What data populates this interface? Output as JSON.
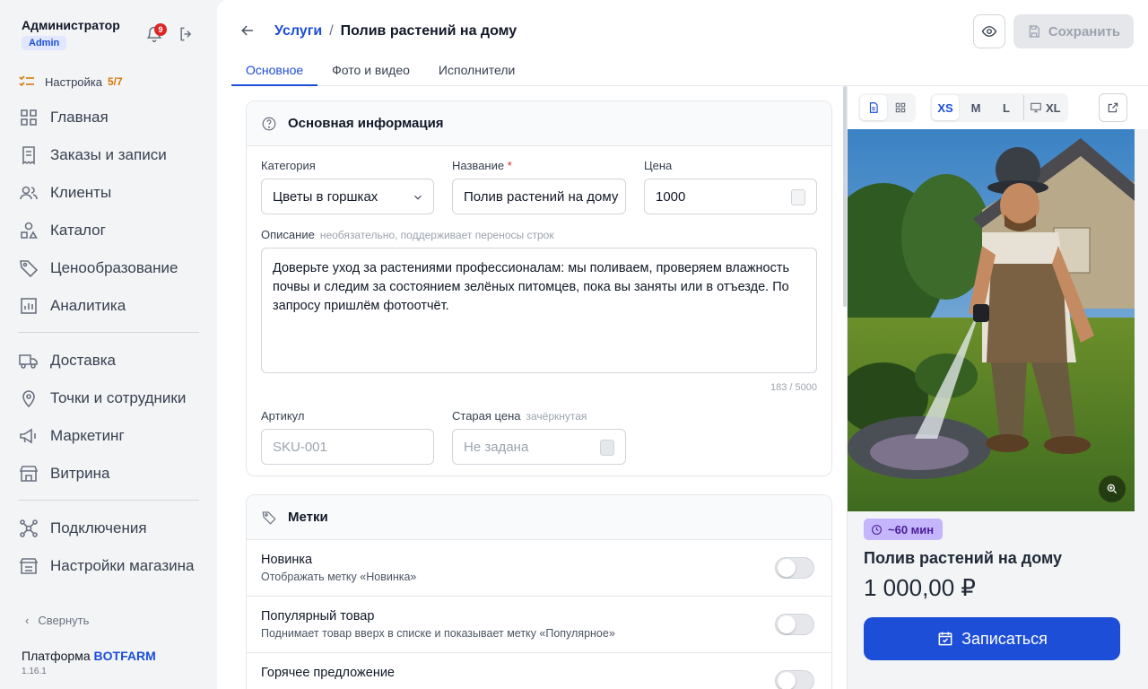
{
  "user": {
    "name": "Администратор",
    "role": "Admin",
    "notifications": "9"
  },
  "sidebar": {
    "setup": {
      "label": "Настройка",
      "progress": "5/7"
    },
    "groups": [
      [
        {
          "label": "Главная",
          "icon": "grid-icon"
        },
        {
          "label": "Заказы и записи",
          "icon": "receipt-icon"
        },
        {
          "label": "Клиенты",
          "icon": "users-icon"
        },
        {
          "label": "Каталог",
          "icon": "shapes-icon"
        },
        {
          "label": "Ценообразование",
          "icon": "tag-icon"
        },
        {
          "label": "Аналитика",
          "icon": "chart-icon"
        }
      ],
      [
        {
          "label": "Доставка",
          "icon": "truck-icon"
        },
        {
          "label": "Точки и сотрудники",
          "icon": "map-pin-icon"
        },
        {
          "label": "Маркетинг",
          "icon": "megaphone-icon"
        },
        {
          "label": "Витрина",
          "icon": "store-icon"
        }
      ],
      [
        {
          "label": "Подключения",
          "icon": "network-icon"
        },
        {
          "label": "Настройки магазина",
          "icon": "store-settings-icon"
        }
      ]
    ],
    "collapse": "Свернуть",
    "platform_prefix": "Платформа",
    "platform_brand": "BOTFARM",
    "version": "1.16.1"
  },
  "header": {
    "breadcrumb_link": "Услуги",
    "separator": "/",
    "breadcrumb_current": "Полив растений на дому",
    "save": "Сохранить"
  },
  "tabs": [
    "Основное",
    "Фото и видео",
    "Исполнители"
  ],
  "basic": {
    "title": "Основная информация",
    "category_label": "Категория",
    "category_value": "Цветы в горшках",
    "name_label": "Название",
    "name_value": "Полив растений на дому",
    "price_label": "Цена",
    "price_value": "1000",
    "desc_label": "Описание",
    "desc_hint": "необязательно, поддерживает переносы строк",
    "desc_value": "Доверьте уход за растениями профессионалам: мы поливаем, проверяем влажность почвы и следим за состоянием зелёных питомцев, пока вы заняты или в отъезде. По запросу пришлём фотоотчёт.",
    "counter": "183 / 5000",
    "sku_label": "Артикул",
    "sku_placeholder": "SKU-001",
    "old_price_label": "Старая цена",
    "old_price_hint": "зачёркнутая",
    "old_price_placeholder": "Не задана"
  },
  "tags": {
    "title": "Метки",
    "items": [
      {
        "title": "Новинка",
        "subtitle": "Отображать метку «Новинка»",
        "enabled": false
      },
      {
        "title": "Популярный товар",
        "subtitle": "Поднимает товар вверх в списке и показывает метку «Популярное»",
        "enabled": false
      },
      {
        "title": "Горячее предложение",
        "subtitle": "",
        "enabled": false
      }
    ]
  },
  "preview": {
    "sizes": [
      "XS",
      "M",
      "L",
      "XL"
    ],
    "active_size": "XS",
    "duration": "~60 мин",
    "title": "Полив растений на дому",
    "price": "1 000,00 ₽",
    "cta": "Записаться"
  },
  "colors": {
    "accent": "#1d4ed8",
    "badge": "#c4b5fd",
    "warning": "#d97706",
    "danger": "#dc2626"
  }
}
